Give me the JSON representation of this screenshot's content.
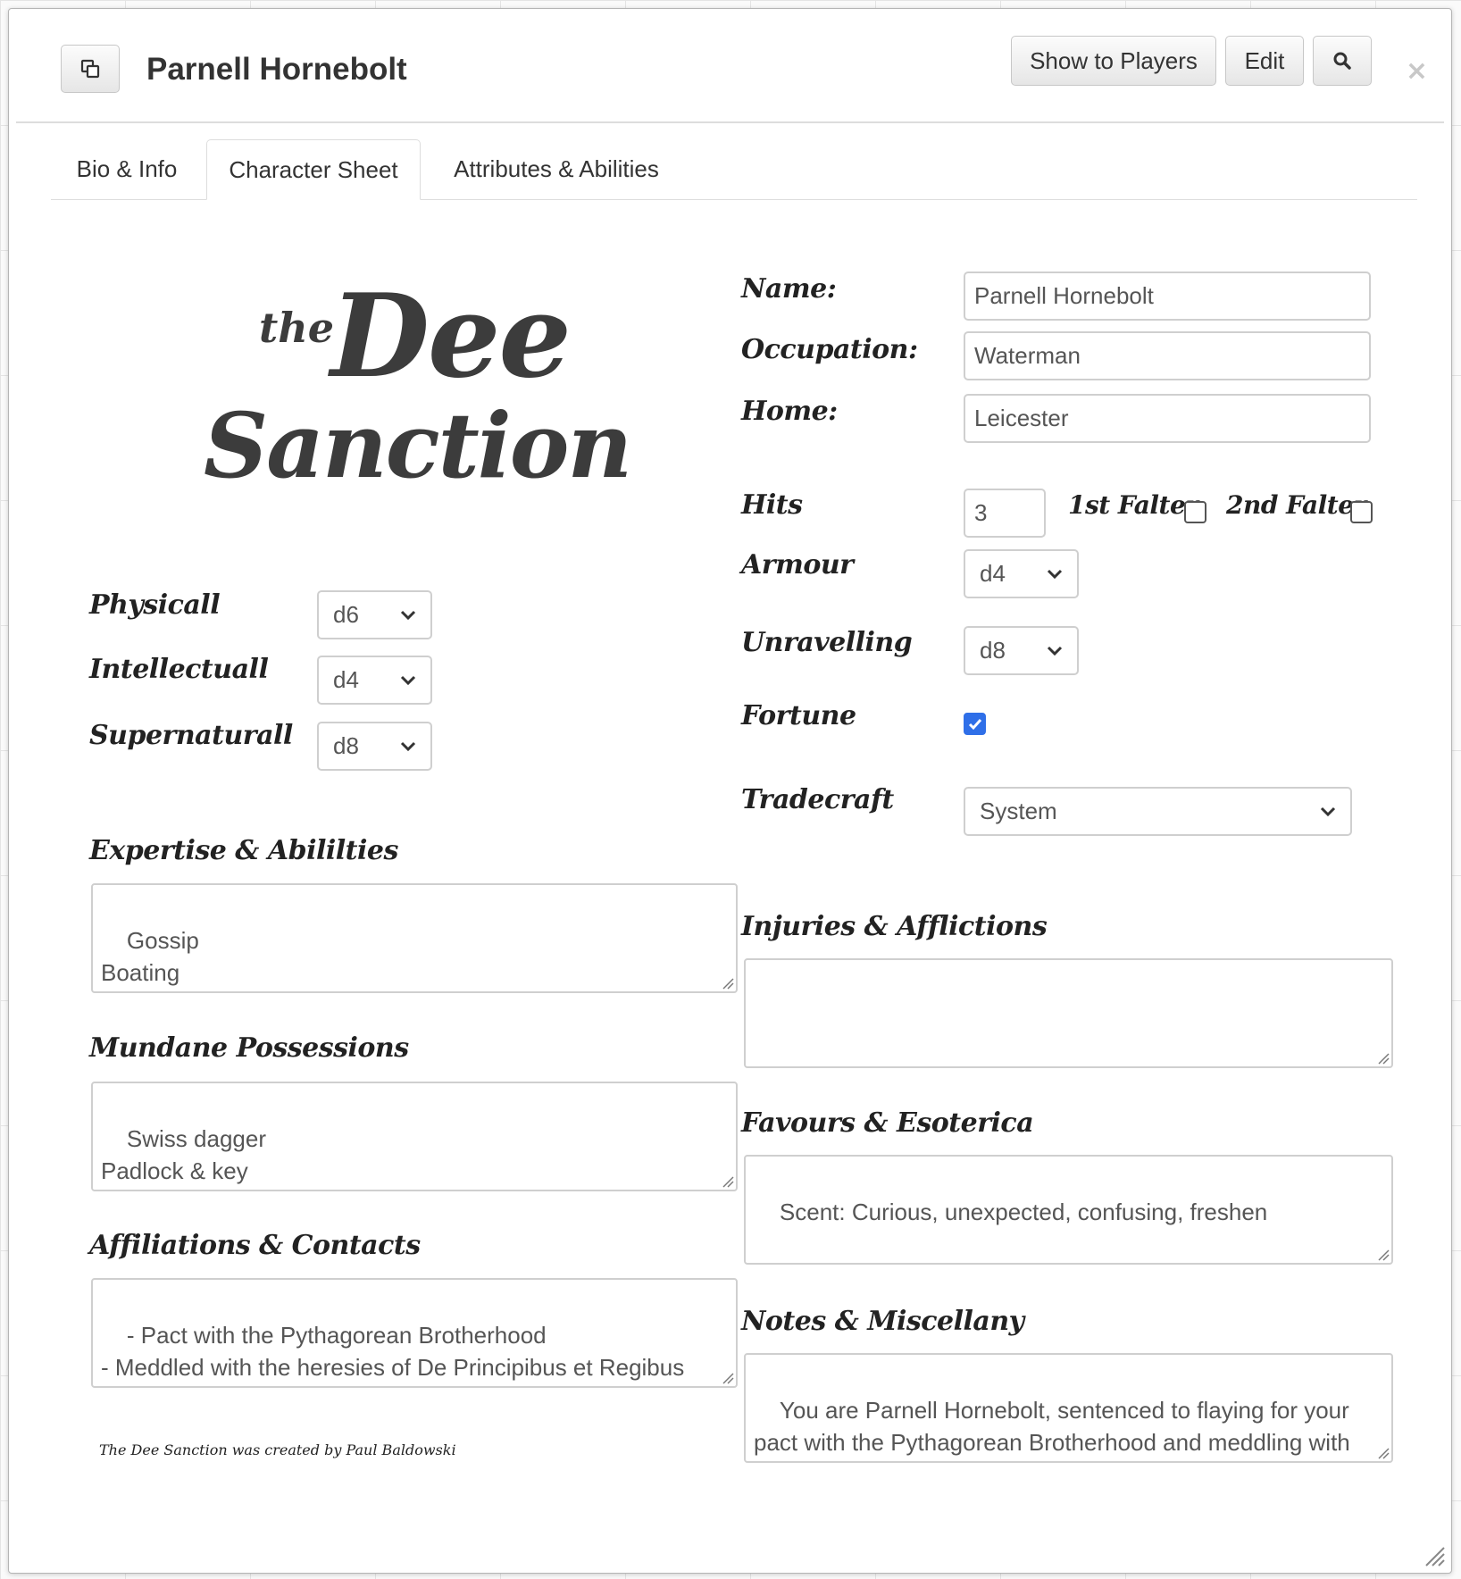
{
  "window": {
    "title": "Parnell Hornebolt",
    "buttons": {
      "show_to_players": "Show to Players",
      "edit": "Edit"
    },
    "close": "×"
  },
  "tabs": [
    "Bio & Info",
    "Character Sheet",
    "Attributes & Abilities"
  ],
  "active_tab": "Character Sheet",
  "logo": {
    "the": "the",
    "dee": "Dee",
    "sanction": "Sanction"
  },
  "fields": {
    "name": {
      "label": "Name:",
      "value": "Parnell Hornebolt"
    },
    "occupation": {
      "label": "Occupation:",
      "value": "Waterman"
    },
    "home": {
      "label": "Home:",
      "value": "Leicester"
    },
    "hits": {
      "label": "Hits",
      "value": "3"
    },
    "first_falter": {
      "label": "1st Falter",
      "checked": false
    },
    "second_falter": {
      "label": "2nd Falter",
      "checked": false
    },
    "armour": {
      "label": "Armour",
      "value": "d4"
    },
    "unravelling": {
      "label": "Unravelling",
      "value": "d8"
    },
    "fortune": {
      "label": "Fortune",
      "checked": true
    },
    "tradecraft": {
      "label": "Tradecraft",
      "value": "System"
    }
  },
  "attributes": {
    "physicall": {
      "label": "Physicall",
      "value": "d6"
    },
    "intellectuall": {
      "label": "Intellectuall",
      "value": "d4"
    },
    "supernaturall": {
      "label": "Supernaturall",
      "value": "d8"
    }
  },
  "text_areas": {
    "expertise": {
      "label": "Expertise & Abililties",
      "value": "Gossip\nBoating\nNumerology"
    },
    "possessions": {
      "label": "Mundane Possessions",
      "value": "Swiss dagger\nPadlock & key\nWool coat"
    },
    "affiliations": {
      "label": "Affiliations & Contacts",
      "value": "- Pact with the Pythagorean Brotherhood\n- Meddled with the heresies of De Principibus et Regibus Daemoniorium"
    },
    "injuries": {
      "label": "Injuries & Afflictions",
      "value": ""
    },
    "favours": {
      "label": "Favours & Esoterica",
      "value": "Scent: Curious, unexpected, confusing, freshen"
    },
    "notes": {
      "label": "Notes & Miscellany",
      "value": "You are Parnell Hornebolt, sentenced to flaying for your pact with the Pythagorean Brotherhood and meddling with the heresies of the De Principibus et Regibus Daemoniorium"
    }
  },
  "credit": "The Dee Sanction was created by Paul Baldowski",
  "colors": {
    "checkbox_checked": "#2f6fe8",
    "border": "#cfcfcf"
  }
}
